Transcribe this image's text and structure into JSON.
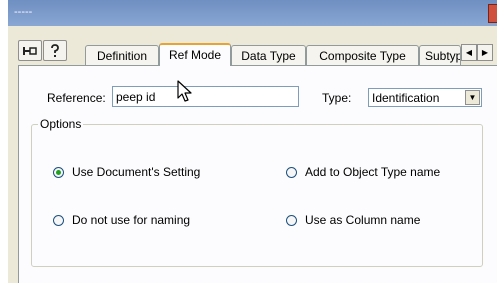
{
  "window": {
    "title": "-----"
  },
  "toolbar": {
    "pin_icon": "pin-icon",
    "help_icon": "help-icon"
  },
  "tabs": [
    {
      "label": "Definition",
      "active": false
    },
    {
      "label": "Ref Mode",
      "active": true
    },
    {
      "label": "Data Type",
      "active": false
    },
    {
      "label": "Composite Type",
      "active": false
    },
    {
      "label": "Subtyp",
      "active": false
    }
  ],
  "tab_scroll": {
    "left_icon": "scroll-left-icon",
    "right_icon": "scroll-right-icon"
  },
  "reference": {
    "label": "Reference:",
    "value": "peep id"
  },
  "type": {
    "label": "Type:",
    "value": "Identification"
  },
  "options": {
    "legend": "Options",
    "items": [
      {
        "label": "Use Document's Setting",
        "checked": true
      },
      {
        "label": "Add to Object Type name",
        "checked": false
      },
      {
        "label": "Do not use for naming",
        "checked": false
      },
      {
        "label": "Use as Column name",
        "checked": false
      }
    ]
  },
  "colors": {
    "dialog_bg": "#ece9d8",
    "panel_bg": "#fcfcfe",
    "active_tab_accent": "#e6a532",
    "radio_dot": "#21a121",
    "title_bar": "#7b9bcb"
  }
}
